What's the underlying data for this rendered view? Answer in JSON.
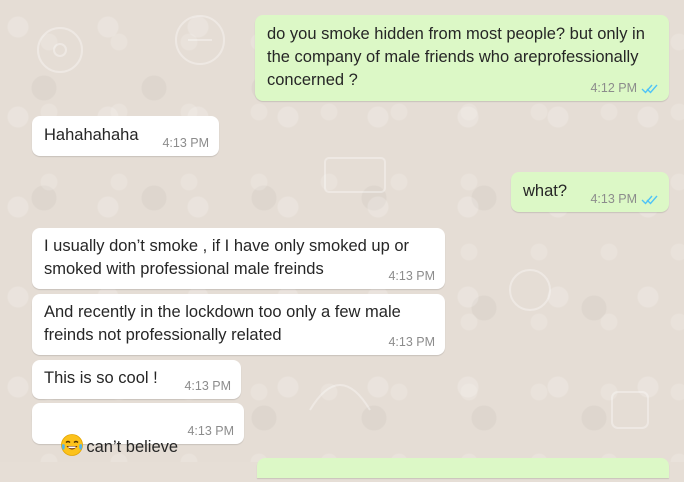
{
  "colors": {
    "incoming_bubble": "#ffffff",
    "outgoing_bubble": "#dcf8c6",
    "read_ticks": "#4fc3f7",
    "time": "#8c8c8c",
    "wallpaper": "#e5ddd5"
  },
  "messages": [
    {
      "direction": "outgoing",
      "text": "do you smoke hidden from most people? but only in the company of male friends who areprofessionally concerned ?",
      "time": "4:12 PM",
      "status_icon": "double-check-read-icon"
    },
    {
      "direction": "incoming",
      "text": "Hahahahaha",
      "time": "4:13 PM"
    },
    {
      "direction": "outgoing",
      "text": "what?",
      "time": "4:13 PM",
      "status_icon": "double-check-read-icon"
    },
    {
      "direction": "incoming",
      "text": "I usually don’t smoke , if I have only smoked up or smoked with professional male freinds",
      "time": "4:13 PM"
    },
    {
      "direction": "incoming",
      "text": "And recently in the lockdown too only a few male freinds not professionally related",
      "time": "4:13 PM"
    },
    {
      "direction": "incoming",
      "text": "This is so cool !",
      "time": "4:13 PM"
    },
    {
      "direction": "incoming",
      "emoji": "face-with-tears-of-joy-icon",
      "text": "can’t believe",
      "time": "4:13 PM"
    }
  ]
}
